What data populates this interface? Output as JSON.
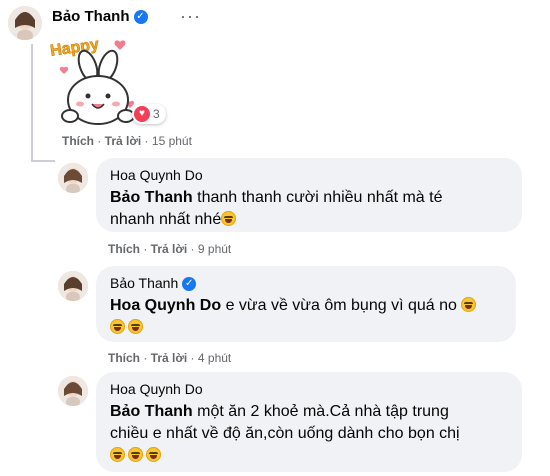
{
  "top_comment": {
    "author": "Bảo Thanh",
    "reaction_count": "3",
    "sticker_text": "Happy",
    "actions": {
      "like": "Thích",
      "reply": "Trả lời",
      "time": "15 phút"
    }
  },
  "replies": [
    {
      "author": "Hoa Quynh Do",
      "mention": "Bảo Thanh",
      "text_line1": "thanh thanh cười nhiều nhất mà té",
      "text_line2": "nhanh nhất nhé",
      "actions": {
        "like": "Thích",
        "reply": "Trả lời",
        "time": "9 phút"
      }
    },
    {
      "author": "Bảo Thanh",
      "mention": "Hoa Quynh Do",
      "text_line1": "e vừa về vừa ôm bụng vì quá no",
      "actions": {
        "like": "Thích",
        "reply": "Trả lời",
        "time": "4 phút"
      }
    },
    {
      "author": "Hoa Quynh Do",
      "mention": "Bảo Thanh",
      "text_line1": "một ăn 2 khoẻ mà.Cả nhà tập trung",
      "text_line2": "chiều e nhất về độ ăn,còn uống dành cho bọn chị"
    }
  ],
  "more_icon": "more-options-icon",
  "verified_icon": "verified-badge-icon",
  "emoji_icon": "laughing-emoji-icon"
}
